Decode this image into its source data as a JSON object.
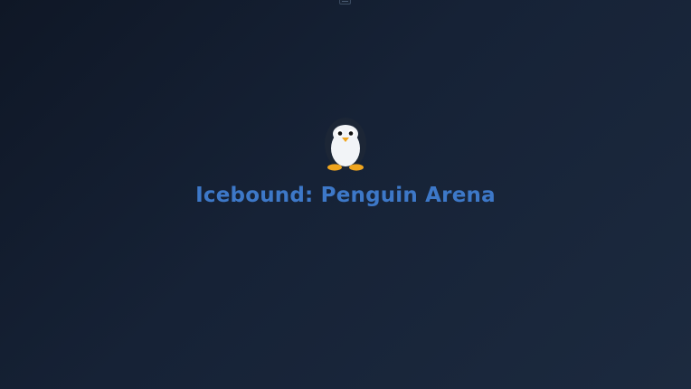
{
  "app": {
    "title": "Icebound: Penguin Arena",
    "logo_icon": "penguin-icon"
  },
  "colors": {
    "background_start": "#0f1726",
    "background_end": "#1c2a3f",
    "title": "#3d78c8",
    "penguin_body": "#1c2636",
    "penguin_belly": "#f2f4f7",
    "penguin_beak": "#f0a51e",
    "penguin_feet": "#f0a51e"
  }
}
